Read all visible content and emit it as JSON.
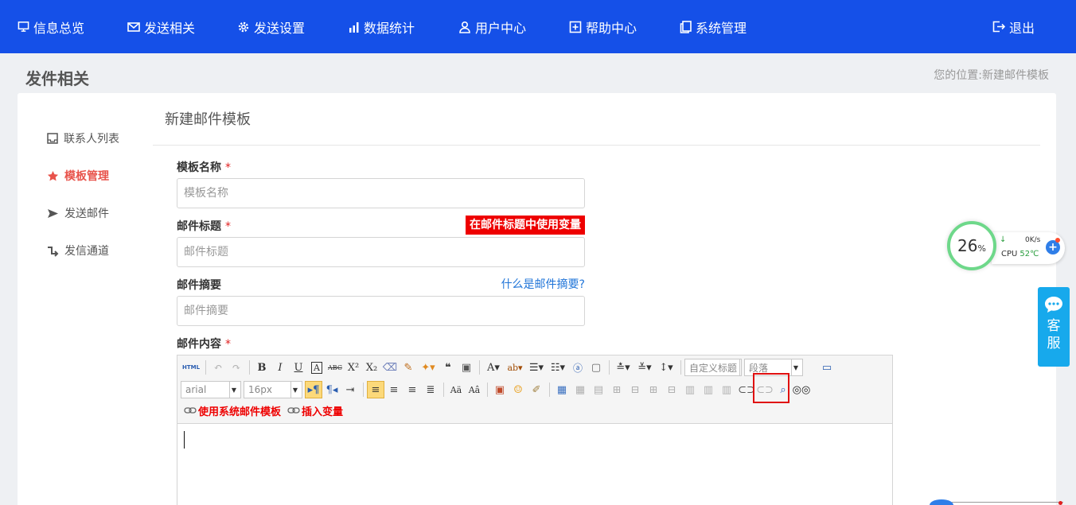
{
  "nav": {
    "items": [
      {
        "label": "信息总览",
        "icon": "monitor-icon"
      },
      {
        "label": "发送相关",
        "icon": "mail-icon"
      },
      {
        "label": "发送设置",
        "icon": "gear-icon"
      },
      {
        "label": "数据统计",
        "icon": "bar-chart-icon"
      },
      {
        "label": "用户中心",
        "icon": "user-icon"
      },
      {
        "label": "帮助中心",
        "icon": "help-icon"
      },
      {
        "label": "系统管理",
        "icon": "copy-icon"
      }
    ],
    "logout": "退出"
  },
  "header": {
    "title": "发件相关",
    "breadcrumb": "您的位置:新建邮件模板"
  },
  "sidebar": {
    "items": [
      {
        "label": "联系人列表",
        "icon": "inbox-icon",
        "active": false
      },
      {
        "label": "模板管理",
        "icon": "star-icon",
        "active": true
      },
      {
        "label": "发送邮件",
        "icon": "send-icon",
        "active": false
      },
      {
        "label": "发信通道",
        "icon": "route-icon",
        "active": false
      }
    ]
  },
  "form": {
    "title": "新建邮件模板",
    "template_name": {
      "label": "模板名称",
      "required": "*",
      "placeholder": "模板名称"
    },
    "subject": {
      "label": "邮件标题",
      "required": "*",
      "placeholder": "邮件标题",
      "var_tag": "在邮件标题中使用变量"
    },
    "summary": {
      "label": "邮件摘要",
      "placeholder": "邮件摘要",
      "help_link": "什么是邮件摘要?"
    },
    "content": {
      "label": "邮件内容",
      "required": "*"
    }
  },
  "editor": {
    "html_btn": "HTML",
    "font_family": "arial",
    "font_size": "16px",
    "custom_title": "自定义标题",
    "paragraph": "段落",
    "use_template_btn": "使用系统邮件模板",
    "insert_var_btn": "插入变量"
  },
  "widgets": {
    "cpu_percent": "26",
    "cpu_percent_unit": "%",
    "net_speed": "0K/s",
    "cpu_label": "CPU",
    "cpu_temp": "52℃",
    "plus": "+",
    "kefu": "客服"
  },
  "colors": {
    "nav_bg": "#1550e8",
    "active": "#e8534b",
    "required": "#e02020",
    "var_tag_bg": "#ee0000",
    "link": "#1f74d8",
    "kefu_bg": "#17a9ec"
  }
}
